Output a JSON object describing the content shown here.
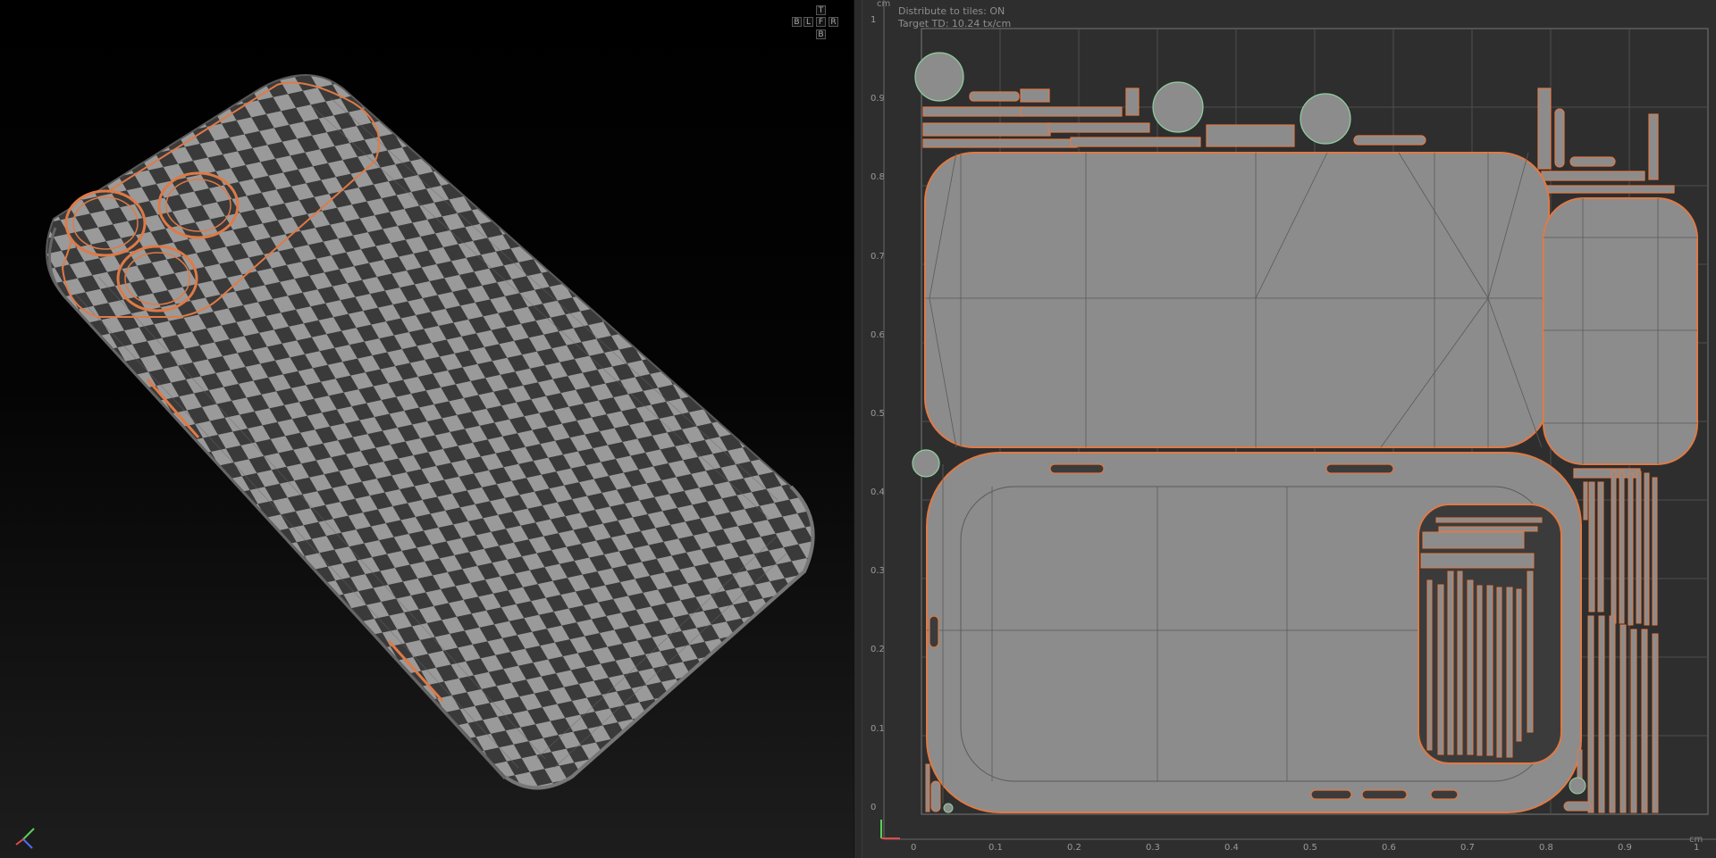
{
  "viewport3d": {
    "viewcube": {
      "top": "T",
      "back": "B",
      "left": "L",
      "front": "F",
      "right": "R",
      "bottom": "B"
    }
  },
  "uv_editor": {
    "info_lines": [
      "Distribute to tiles: ON",
      "Target TD: 10.24 tx/cm"
    ],
    "unit_top": "cm",
    "unit_bottom": "cm",
    "y_ticks": [
      "1",
      "0.9",
      "0.8",
      "0.7",
      "0.6",
      "0.5",
      "0.4",
      "0.3",
      "0.2",
      "0.1",
      "0"
    ],
    "x_ticks": [
      "0",
      "0.1",
      "0.2",
      "0.3",
      "0.4",
      "0.5",
      "0.6",
      "0.7",
      "0.8",
      "0.9",
      "1"
    ]
  },
  "colors": {
    "seam": "#e07a45",
    "uv_fill": "#8c8c8c",
    "checker_dark": "#3a3a3a",
    "checker_light": "#9a9a9a",
    "grid": "#5a5a5a"
  }
}
